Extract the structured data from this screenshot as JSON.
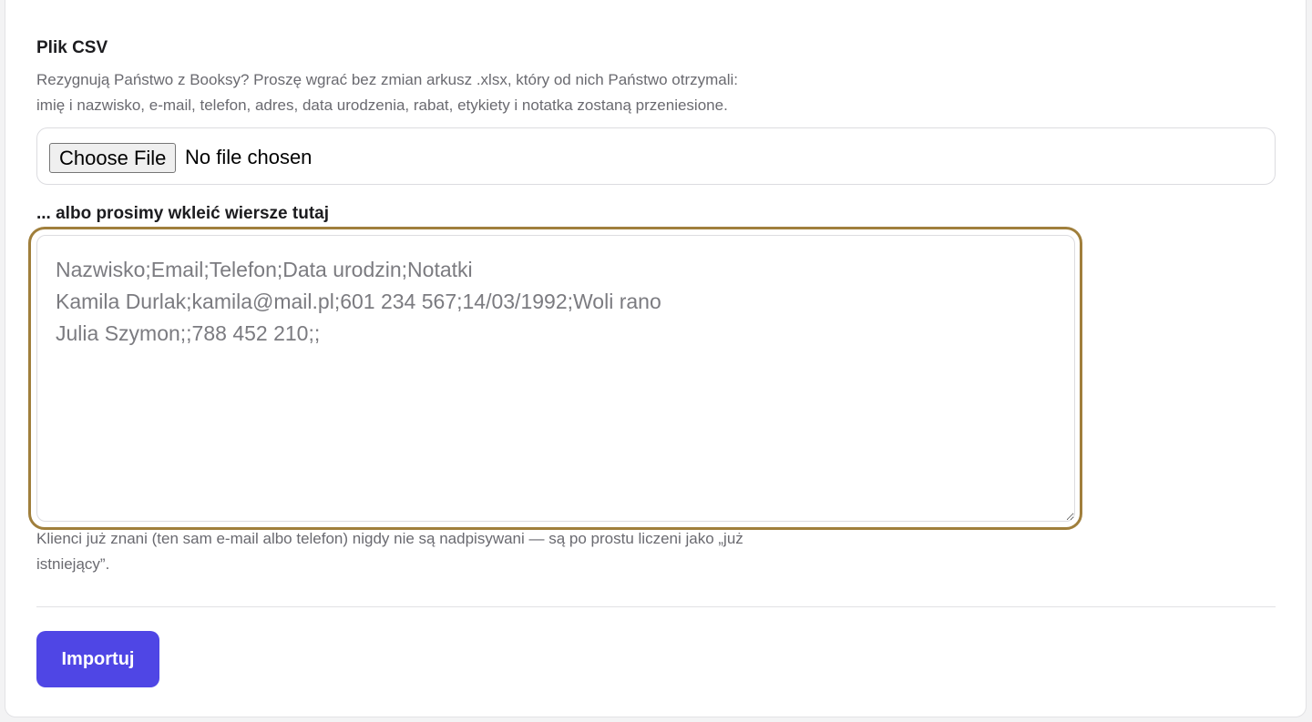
{
  "csv_section": {
    "title": "Plik CSV",
    "help_line1": "Rezygnują Państwo z Booksy? Proszę wgrać bez zmian arkusz .xlsx, który od nich Państwo otrzymali:",
    "help_line2": "imię i nazwisko, e-mail, telefon, adres, data urodzenia, rabat, etykiety i notatka zostaną przeniesione."
  },
  "file_input": {
    "button_label": "Choose File",
    "status": "No file chosen"
  },
  "paste_section": {
    "title": "... albo prosimy wkleić wiersze tutaj",
    "placeholder": "Nazwisko;Email;Telefon;Data urodzin;Notatki\nKamila Durlak;kamila@mail.pl;601 234 567;14/03/1992;Woli rano\nJulia Szymon;;788 452 210;;",
    "value": "",
    "footnote_line1": "Klienci już znani (ten sam e-mail albo telefon) nigdy nie są nadpisywani — są po prostu liczeni jako „już",
    "footnote_line2": "istniejący”."
  },
  "actions": {
    "import_label": "Importuj"
  },
  "colors": {
    "accent": "#4f46e5",
    "focus_ring": "#a07f3c"
  }
}
